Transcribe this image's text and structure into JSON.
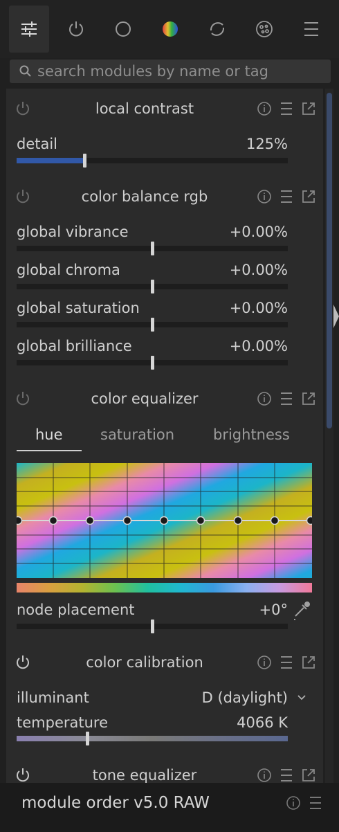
{
  "tabs": [
    {
      "name": "active-modules",
      "icon": "sliders-icon"
    },
    {
      "name": "favorite-modules",
      "icon": "power-icon"
    },
    {
      "name": "base-modules",
      "icon": "circle-icon"
    },
    {
      "name": "color-modules",
      "icon": "color-sphere-icon"
    },
    {
      "name": "correct-modules",
      "icon": "refresh-icon"
    },
    {
      "name": "effect-modules",
      "icon": "effects-icon"
    },
    {
      "name": "presets-menu",
      "icon": "menu-icon"
    }
  ],
  "search": {
    "placeholder": "search modules by name or tag"
  },
  "local_contrast": {
    "title": "local contrast",
    "detail": {
      "label": "detail",
      "value": "125%",
      "fraction": 0.25
    }
  },
  "color_balance": {
    "title": "color balance rgb",
    "sliders": [
      {
        "label": "global vibrance",
        "value": "+0.00%"
      },
      {
        "label": "global chroma",
        "value": "+0.00%"
      },
      {
        "label": "global saturation",
        "value": "+0.00%"
      },
      {
        "label": "global brilliance",
        "value": "+0.00%"
      }
    ]
  },
  "color_equalizer": {
    "title": "color equalizer",
    "tabs": [
      "hue",
      "saturation",
      "brightness"
    ],
    "node_placement": {
      "label": "node placement",
      "value": "+0°"
    }
  },
  "color_calibration": {
    "title": "color calibration",
    "illuminant": {
      "label": "illuminant",
      "value": "D (daylight)"
    },
    "temperature": {
      "label": "temperature",
      "value": "4066 K",
      "fraction": 0.26
    }
  },
  "tone_equalizer": {
    "title": "tone equalizer"
  },
  "footer": {
    "label": "module order",
    "value": "v5.0 RAW"
  },
  "colors": {
    "accent": "#3158a8",
    "panel": "#2b2b2b",
    "background": "#202020"
  }
}
